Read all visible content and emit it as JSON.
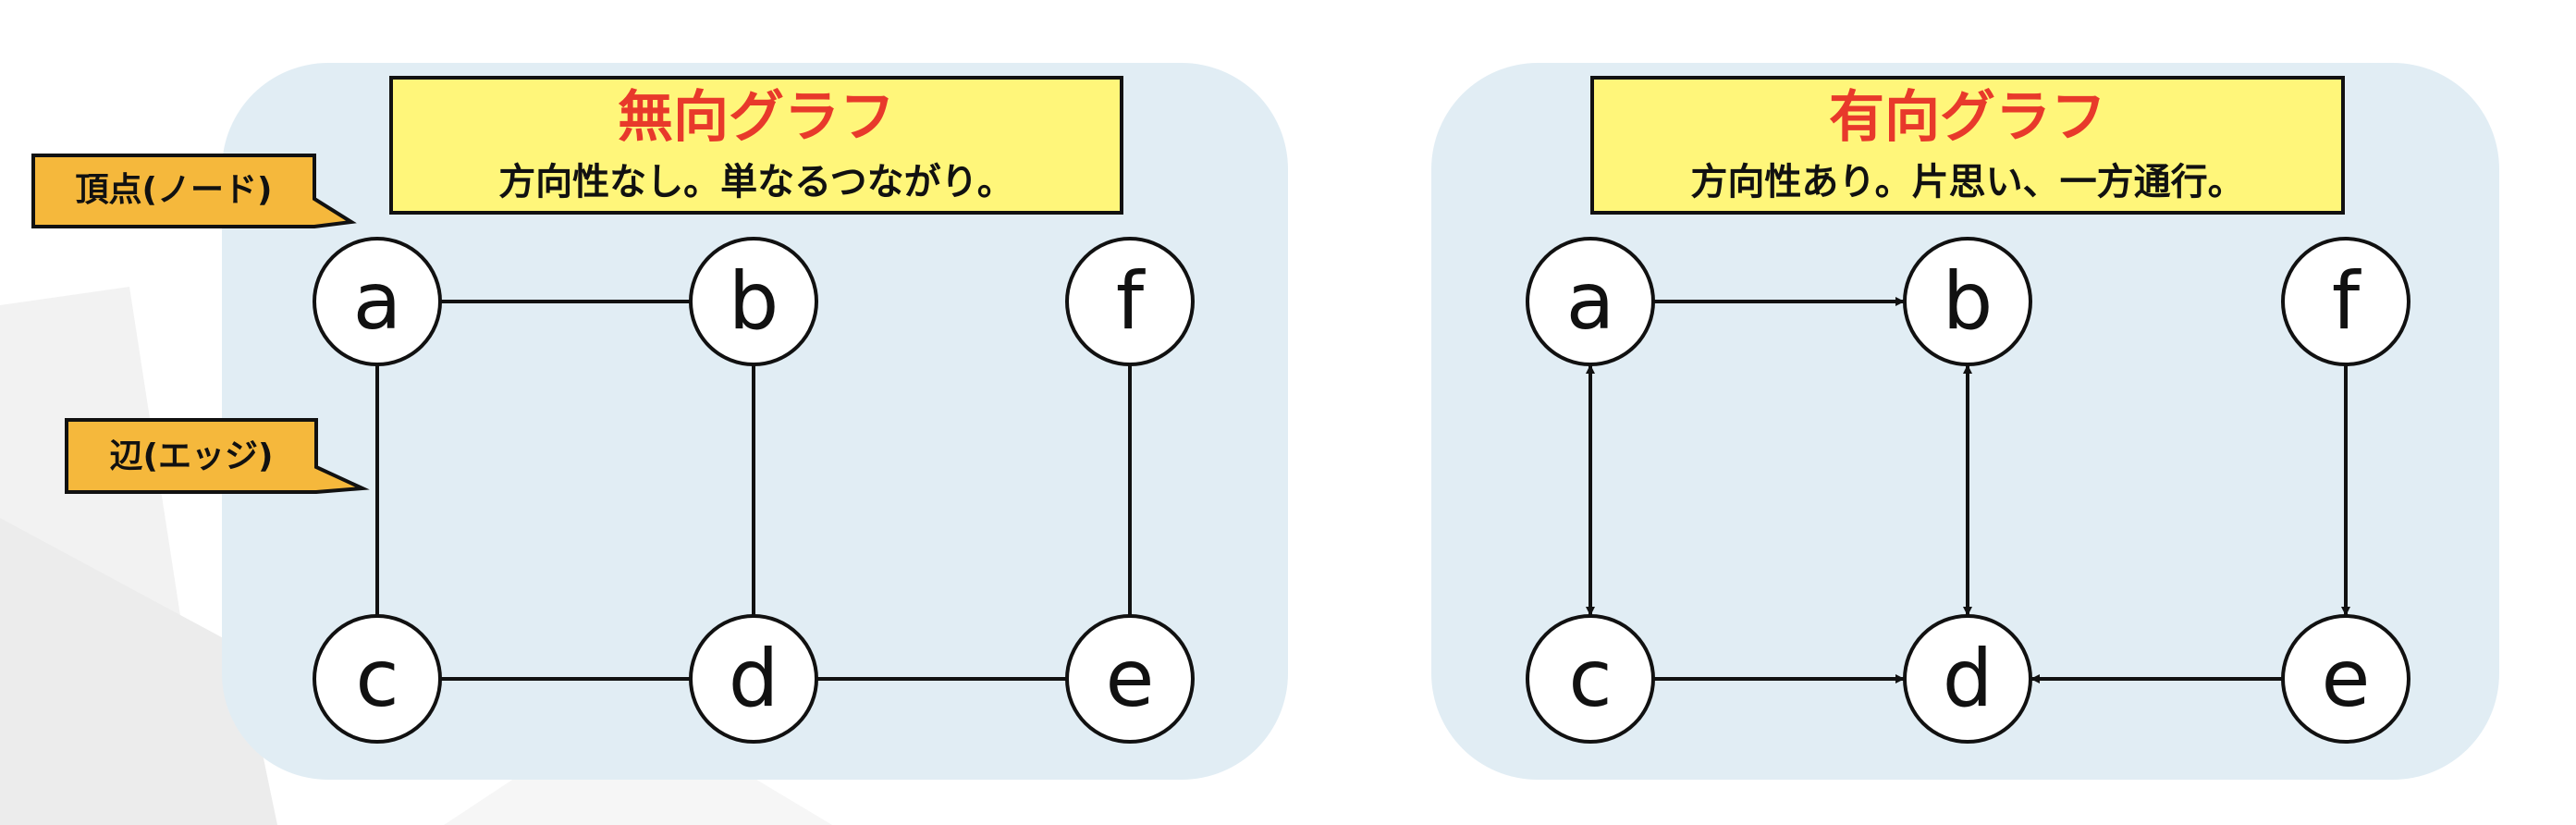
{
  "colors": {
    "panel_background": "#e1edf4",
    "title_box_fill": "#fff67a",
    "title_text": "#e8392b",
    "callout_fill": "#f5b83c",
    "node_fill": "#ffffff",
    "stroke": "#111111"
  },
  "callouts": {
    "vertex": "頂点(ノード)",
    "edge": "辺(エッジ)"
  },
  "undirected": {
    "title": "無向グラフ",
    "subtitle": "方向性なし。単なるつながり。",
    "nodes": [
      {
        "id": "a",
        "label": "a"
      },
      {
        "id": "b",
        "label": "b"
      },
      {
        "id": "f",
        "label": "f"
      },
      {
        "id": "c",
        "label": "c"
      },
      {
        "id": "d",
        "label": "d"
      },
      {
        "id": "e",
        "label": "e"
      }
    ],
    "edges": [
      {
        "from": "a",
        "to": "b"
      },
      {
        "from": "a",
        "to": "c"
      },
      {
        "from": "b",
        "to": "d"
      },
      {
        "from": "f",
        "to": "e"
      },
      {
        "from": "c",
        "to": "d"
      },
      {
        "from": "d",
        "to": "e"
      }
    ]
  },
  "directed": {
    "title": "有向グラフ",
    "subtitle": "方向性あり。片思い、一方通行。",
    "nodes": [
      {
        "id": "a",
        "label": "a"
      },
      {
        "id": "b",
        "label": "b"
      },
      {
        "id": "f",
        "label": "f"
      },
      {
        "id": "c",
        "label": "c"
      },
      {
        "id": "d",
        "label": "d"
      },
      {
        "id": "e",
        "label": "e"
      }
    ],
    "edges": [
      {
        "from": "a",
        "to": "b",
        "bidirectional": false
      },
      {
        "from": "a",
        "to": "c",
        "bidirectional": true
      },
      {
        "from": "b",
        "to": "d",
        "bidirectional": true
      },
      {
        "from": "f",
        "to": "e",
        "bidirectional": false
      },
      {
        "from": "c",
        "to": "d",
        "bidirectional": false
      },
      {
        "from": "e",
        "to": "d",
        "bidirectional": false
      }
    ]
  }
}
